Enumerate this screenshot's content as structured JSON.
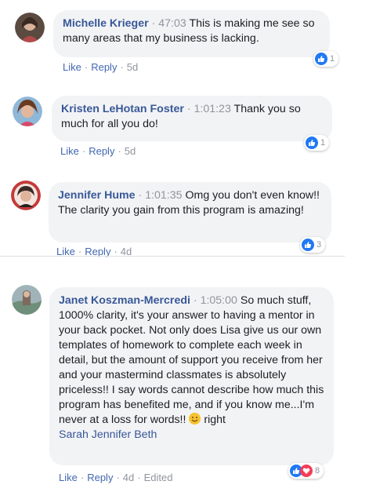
{
  "comments": [
    {
      "author": "Michelle Krieger",
      "timestamp": "47:03",
      "text": "This is making me see so many areas that my business is lacking.",
      "like": "Like",
      "reply": "Reply",
      "age": "5d",
      "reaction_count": "1"
    },
    {
      "author": "Kristen LeHotan Foster",
      "timestamp": "1:01:23",
      "text": "Thank you so much for all you do!",
      "like": "Like",
      "reply": "Reply",
      "age": "5d",
      "reaction_count": "1"
    },
    {
      "author": "Jennifer Hume",
      "timestamp": "1:01:35",
      "text": "Omg you don't even know!! The clarity you gain from this program is amazing!",
      "like": "Like",
      "reply": "Reply",
      "age": "4d",
      "reaction_count": "3"
    },
    {
      "author": "Janet Koszman-Mercredi",
      "timestamp": "1:05:00",
      "text": "So much stuff, 1000% clarity, it's your answer to having a mentor in your back pocket. Not only does Lisa give us our own templates of homework to complete each week in detail, but the amount of support you receive from her and your mastermind classmates is absolutely priceless!! I say words cannot describe how much this program has benefited me, and if you know me...I'm never at a loss for words!!",
      "emoji_after": "right",
      "mention": "Sarah Jennifer Beth",
      "like": "Like",
      "reply": "Reply",
      "age": "4d",
      "edited": "Edited",
      "reaction_count": "8"
    }
  ],
  "separator": "·",
  "colors": {
    "link": "#385898",
    "bubble": "#f2f3f5",
    "like_blue": "#2078f4",
    "love_red": "#f33e58"
  },
  "icons": [
    "like-reaction-icon",
    "love-reaction-icon",
    "smiley-emoji-icon"
  ]
}
